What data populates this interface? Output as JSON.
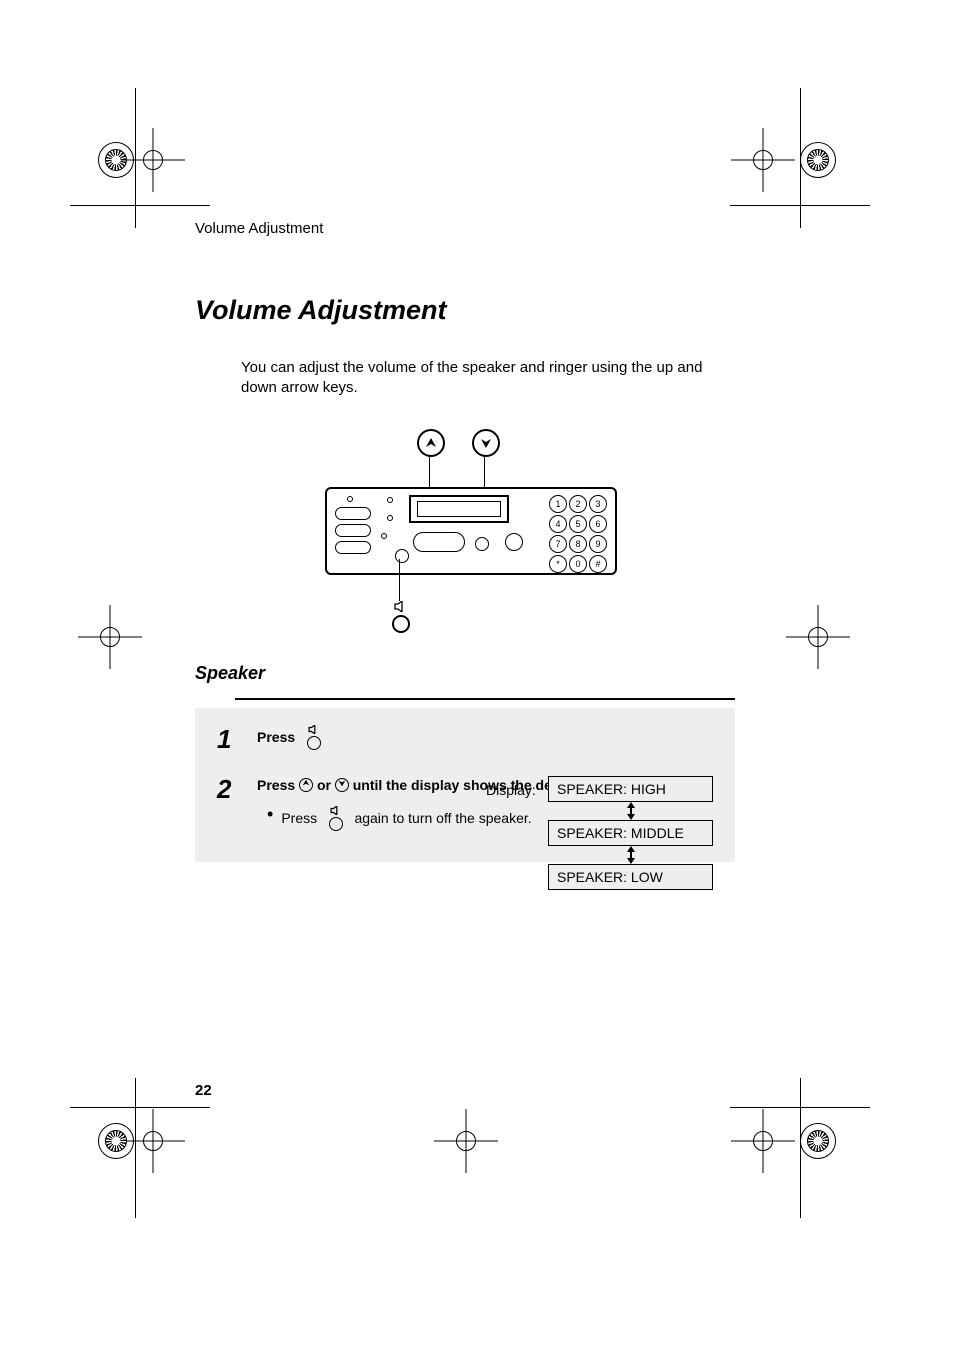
{
  "header": {
    "running": "Volume Adjustment"
  },
  "section": {
    "title": "Volume Adjustment",
    "intro": "You can adjust the volume of the speaker and ringer using the up and down arrow keys."
  },
  "device": {
    "keypad": [
      "1",
      "2",
      "3",
      "4",
      "5",
      "6",
      "7",
      "8",
      "9",
      "*",
      "0",
      "#"
    ]
  },
  "subsection": {
    "title": "Speaker"
  },
  "steps": {
    "s1": {
      "num": "1",
      "text": "Press"
    },
    "s2": {
      "num": "2",
      "line1a": "Press",
      "line1b": "or",
      "line1c": "until the display shows the desired volume level.",
      "bulletA": "Press",
      "bulletB": "again to turn off the speaker."
    }
  },
  "display": {
    "label": "Display:",
    "high": "SPEAKER: HIGH",
    "middle": "SPEAKER: MIDDLE",
    "low": "SPEAKER: LOW"
  },
  "page_number": "22"
}
